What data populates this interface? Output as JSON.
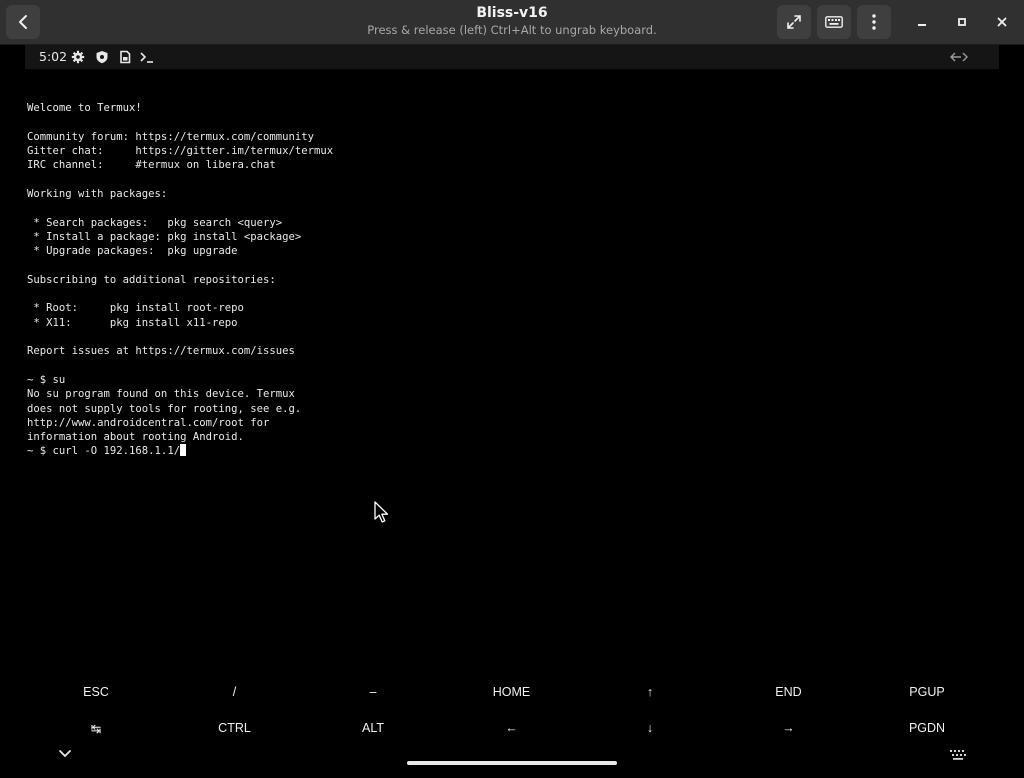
{
  "window": {
    "title": "Bliss-v16",
    "subtitle": "Press & release (left) Ctrl+Alt to ungrab keyboard."
  },
  "statusbar": {
    "time": "5:02",
    "icons": [
      "gear-icon",
      "shield-icon",
      "sim-card-icon",
      "terminal-icon"
    ],
    "right_icon": "expand-horizontal-icon"
  },
  "terminal": {
    "lines": [
      "Welcome to Termux!",
      "",
      "Community forum: https://termux.com/community",
      "Gitter chat:     https://gitter.im/termux/termux",
      "IRC channel:     #termux on libera.chat",
      "",
      "Working with packages:",
      "",
      " * Search packages:   pkg search <query>",
      " * Install a package: pkg install <package>",
      " * Upgrade packages:  pkg upgrade",
      "",
      "Subscribing to additional repositories:",
      "",
      " * Root:     pkg install root-repo",
      " * X11:      pkg install x11-repo",
      "",
      "Report issues at https://termux.com/issues",
      "",
      "~ $ su",
      "No su program found on this device. Termux",
      "does not supply tools for rooting, see e.g.",
      "http://www.androidcentral.com/root for",
      "information about rooting Android."
    ],
    "prompt_line": "~ $ curl -O 192.168.1.1/"
  },
  "extra_keys": {
    "row1": [
      "ESC",
      "/",
      "–",
      "HOME",
      "↑",
      "END",
      "PGUP"
    ],
    "row2": [
      "↹",
      "CTRL",
      "ALT",
      "←",
      "↓",
      "→",
      "PGDN"
    ]
  },
  "colors": {
    "titlebar_bg": "#303030",
    "button_bg": "#3f3f3f",
    "terminal_bg": "#000000",
    "terminal_fg": "#e9e9e9"
  }
}
